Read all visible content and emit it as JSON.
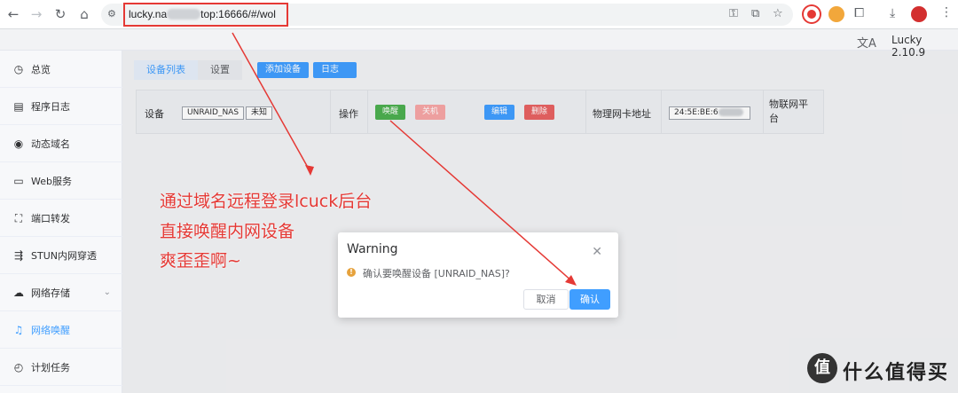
{
  "browser": {
    "url_prefix": "lucky.na",
    "url_suffix": "top:16666/#/wol",
    "icons": [
      "back-icon",
      "forward-icon",
      "reload-icon",
      "home-icon",
      "site-settings-icon",
      "password-key-icon",
      "install-app-icon",
      "bookmark-star-icon",
      "extensions-icon",
      "download-icon"
    ]
  },
  "header": {
    "version": "Lucky 2.10.9",
    "translate_icon": "文A"
  },
  "sidebar": {
    "items": [
      {
        "label": "总览",
        "icon": "dashboard-icon"
      },
      {
        "label": "程序日志",
        "icon": "log-icon"
      },
      {
        "label": "动态域名",
        "icon": "ddns-icon"
      },
      {
        "label": "Web服务",
        "icon": "web-icon"
      },
      {
        "label": "端口转发",
        "icon": "port-forward-icon"
      },
      {
        "label": "STUN内网穿透",
        "icon": "stun-icon"
      },
      {
        "label": "网络存储",
        "icon": "cloud-storage-icon"
      },
      {
        "label": "网络唤醒",
        "icon": "bell-icon"
      },
      {
        "label": "计划任务",
        "icon": "clock-icon"
      }
    ],
    "active_index": 7
  },
  "tabs": {
    "device_list": "设备列表",
    "settings": "设置",
    "add_device": "添加设备",
    "log": "日志"
  },
  "device": {
    "device_label": "设备",
    "device_name": "UNRAID_NAS",
    "status": "未知",
    "ops_label": "操作",
    "wake": "唤醒",
    "shutdown": "关机",
    "edit": "编辑",
    "delete": "删除",
    "mac_label": "物理网卡地址",
    "mac_value": "24:5E:BE:6",
    "iot_label_1": "物联网平",
    "iot_label_2": "台"
  },
  "annotation": {
    "line1": "通过域名远程登录lcuck后台",
    "line2": "直接唤醒内网设备",
    "line3": "爽歪歪啊~"
  },
  "dialog": {
    "title": "Warning",
    "message": "确认要唤醒设备 [UNRAID_NAS]?",
    "cancel": "取消",
    "confirm": "确认"
  },
  "watermark": {
    "logo": "值",
    "text": "什么值得买"
  },
  "colors": {
    "accent": "#409eff",
    "wake": "#4caf50",
    "shutdown": "#f7a6a6",
    "delete": "#e86262",
    "annotation": "#e53935"
  }
}
